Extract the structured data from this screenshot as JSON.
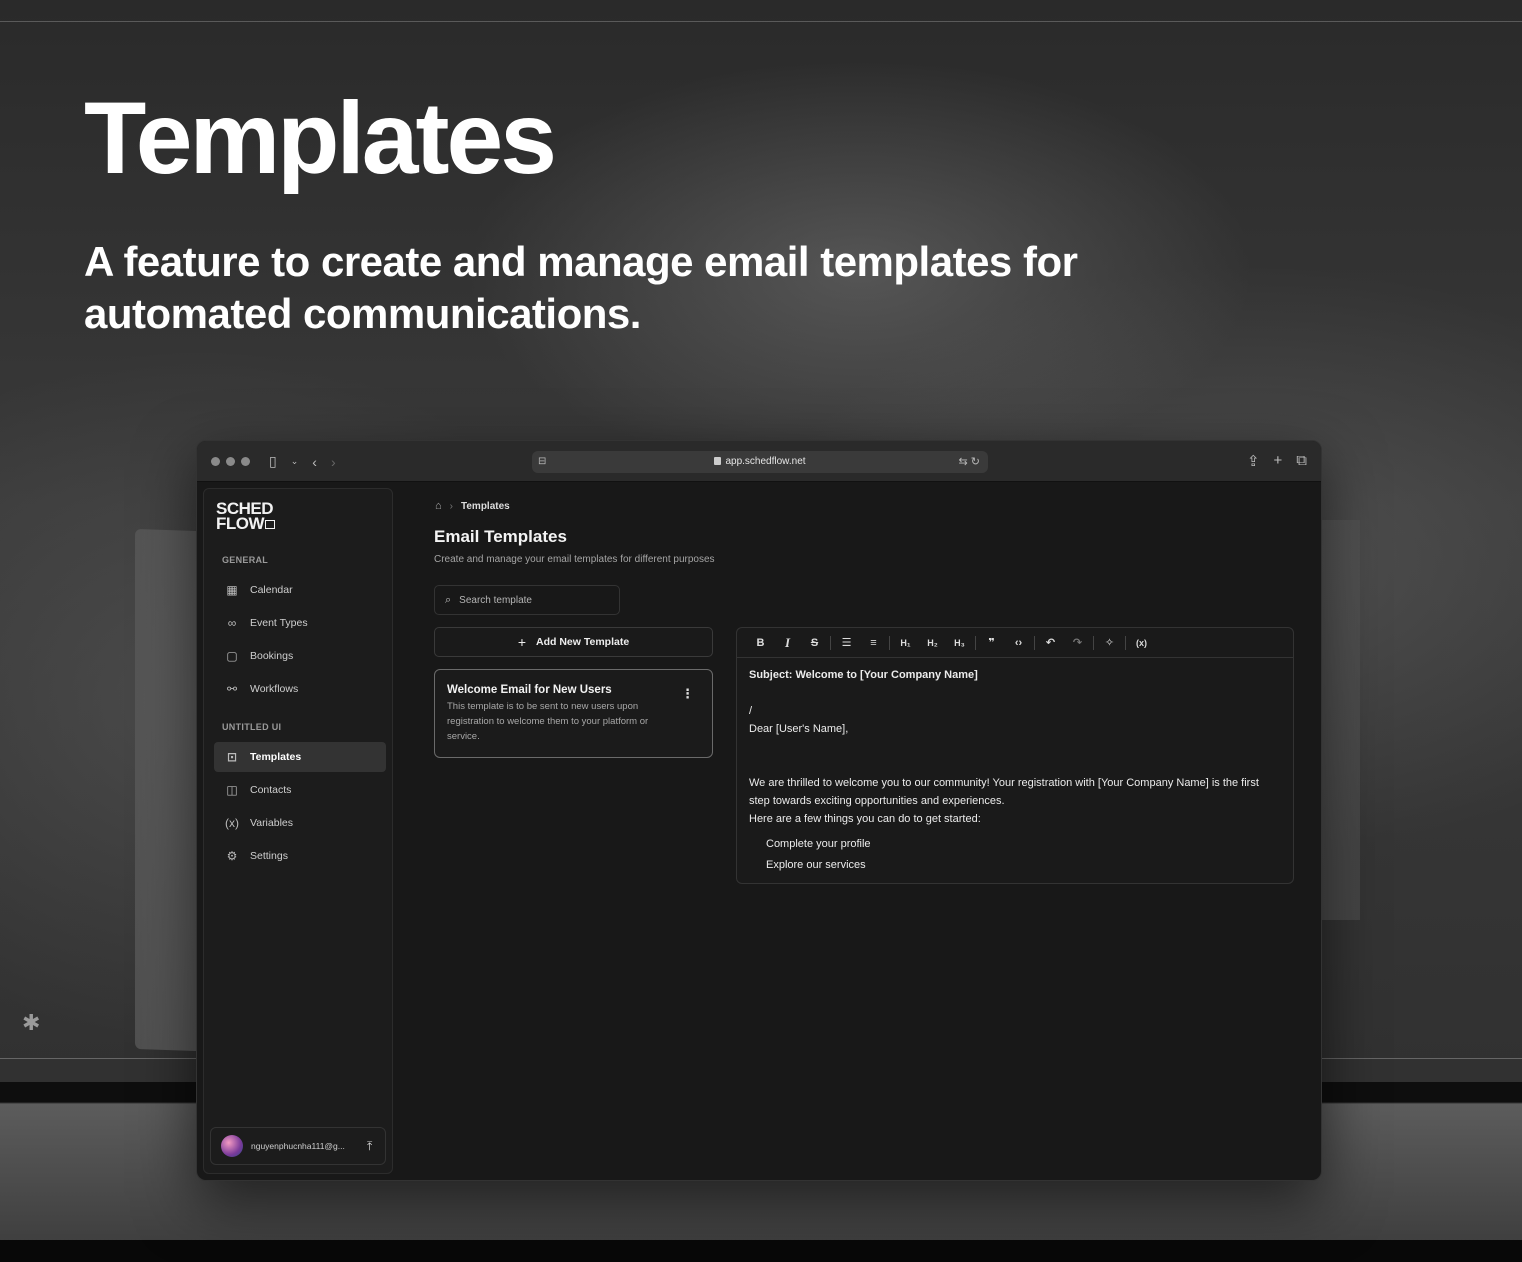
{
  "hero": {
    "title": "Templates",
    "subtitle": "A feature to create and manage email templates for automated communications."
  },
  "browser": {
    "url": "app.schedflow.net"
  },
  "sidebar": {
    "logo_line1": "SCHED",
    "logo_line2": "FLOW",
    "section_general": "GENERAL",
    "section_untitled": "UNTITLED UI",
    "items": [
      {
        "label": "Calendar",
        "icon": "calendar-icon"
      },
      {
        "label": "Event Types",
        "icon": "link-icon"
      },
      {
        "label": "Bookings",
        "icon": "book-icon"
      },
      {
        "label": "Workflows",
        "icon": "workflow-icon"
      },
      {
        "label": "Templates",
        "icon": "folder-icon",
        "active": true
      },
      {
        "label": "Contacts",
        "icon": "contacts-icon"
      },
      {
        "label": "Variables",
        "icon": "variable-icon"
      },
      {
        "label": "Settings",
        "icon": "gear-icon"
      }
    ],
    "user_email": "nguyenphucnha111@g..."
  },
  "main": {
    "breadcrumb_current": "Templates",
    "title": "Email Templates",
    "description": "Create and manage your email templates for different purposes",
    "search_placeholder": "Search template",
    "add_button": "Add New Template",
    "template_card": {
      "name": "Welcome Email for New Users",
      "description": "This template is to be sent to new users upon registration to welcome them to your platform or service."
    }
  },
  "editor": {
    "toolbar": [
      "B",
      "I",
      "S",
      "bullet-list",
      "ordered-list",
      "H1",
      "H2",
      "H3",
      "quote",
      "code",
      "undo",
      "redo",
      "ai-sparkle",
      "variable"
    ],
    "subject": "Subject: Welcome to [Your Company Name]",
    "slash": "/",
    "greeting": "Dear [User's Name],",
    "body1": "We are thrilled to welcome you to our community! Your registration with [Your Company Name] is the first step towards exciting opportunities and experiences.",
    "body2": "Here are a few things you can do to get started:",
    "list": [
      "Complete your profile",
      "Explore our services"
    ]
  }
}
